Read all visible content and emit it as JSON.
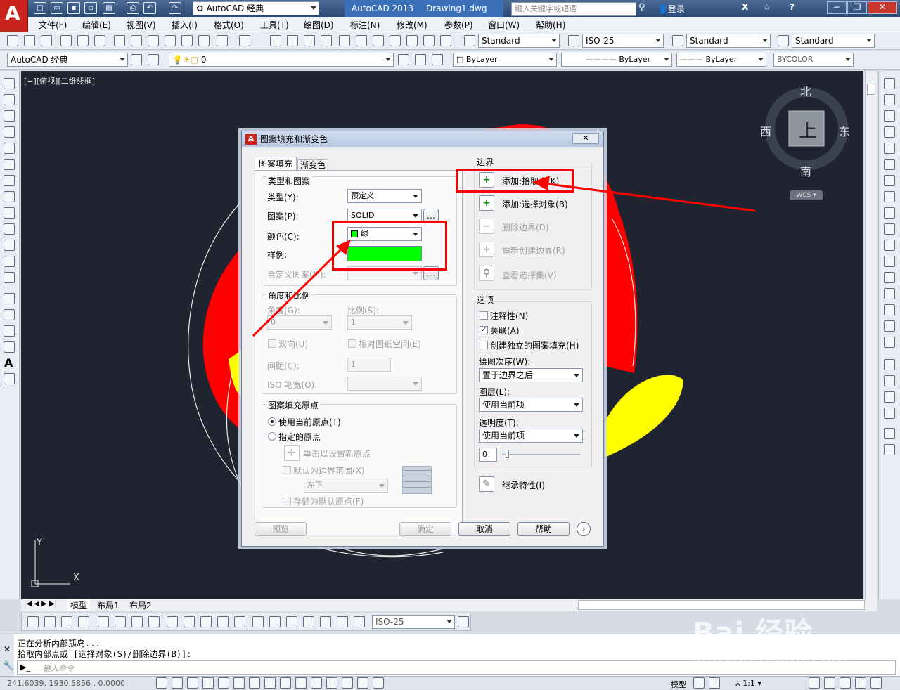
{
  "app": {
    "workspace": "AutoCAD 经典",
    "tab_product": "AutoCAD 2013",
    "tab_file": "Drawing1.dwg",
    "search_placeholder": "键入关键字或短语",
    "login": "登录"
  },
  "menu": [
    "文件(F)",
    "编辑(E)",
    "视图(V)",
    "插入(I)",
    "格式(O)",
    "工具(T)",
    "绘图(D)",
    "标注(N)",
    "修改(M)",
    "参数(P)",
    "窗口(W)",
    "帮助(H)"
  ],
  "styles": {
    "text": "Standard",
    "dim": "ISO-25",
    "table": "Standard",
    "mleader": "Standard"
  },
  "toolbar2": {
    "workspace": "AutoCAD 经典",
    "layer": "0",
    "color": "ByLayer",
    "linetype": "ByLayer",
    "lineweight": "ByLayer",
    "plotstyle": "BYCOLOR"
  },
  "viewport": {
    "label": "[−][俯视][二维线框]",
    "compass": {
      "n": "北",
      "s": "南",
      "e": "东",
      "w": "西",
      "top": "上",
      "wcs": "WCS"
    },
    "ucs_y": "Y",
    "ucs_x": "X"
  },
  "dialog": {
    "title": "图案填充和渐变色",
    "tabs": [
      "图案填充",
      "渐变色"
    ],
    "type_group": "类型和图案",
    "type_label": "类型(Y):",
    "type_value": "预定义",
    "pattern_label": "图案(P):",
    "pattern_value": "SOLID",
    "color_label": "颜色(C):",
    "color_value": "绿",
    "swatch_label": "样例:",
    "custom_label": "自定义图案(M):",
    "angle_group": "角度和比例",
    "angle_label": "角度(G):",
    "angle_value": "0",
    "scale_label": "比例(S):",
    "scale_value": "1",
    "double_label": "双向(U)",
    "relative_label": "相对图纸空间(E)",
    "spacing_label": "间距(C):",
    "spacing_value": "1",
    "iso_label": "ISO 笔宽(O):",
    "origin_group": "图案填充原点",
    "origin_current": "使用当前原点(T)",
    "origin_specified": "指定的原点",
    "click_origin": "单击以设置新原点",
    "default_extent": "默认为边界范围(X)",
    "extent_value": "左下",
    "store_origin": "存储为默认原点(F)",
    "boundary_group": "边界",
    "add_pick": "添加:拾取点(K)",
    "add_select": "添加:选择对象(B)",
    "remove_boundary": "删除边界(D)",
    "recreate_boundary": "重新创建边界(R)",
    "view_selection": "查看选择集(V)",
    "options_group": "选项",
    "annotative": "注释性(N)",
    "associative": "关联(A)",
    "separate": "创建独立的图案填充(H)",
    "draw_order_label": "绘图次序(W):",
    "draw_order_value": "置于边界之后",
    "layer_label": "图层(L):",
    "layer_value": "使用当前项",
    "transparency_label": "透明度(T):",
    "transparency_value": "使用当前项",
    "transparency_num": "0",
    "inherit": "继承特性(I)",
    "preview": "预览",
    "ok": "确定",
    "cancel": "取消",
    "help": "帮助",
    "swatch_color": "#00ff00"
  },
  "layout_tabs": [
    "模型",
    "布局1",
    "布局2"
  ],
  "dimstyle_bottom": "ISO-25",
  "command": {
    "line1": "正在分析内部孤岛...",
    "line2": "拾取内部点或 [选择对象(S)/删除边界(B)]:",
    "placeholder": "键入命令"
  },
  "status": {
    "coords": "241.6039, 1930.5856 , 0.0000",
    "model": "模型",
    "scale": "1:1"
  },
  "watermark": {
    "brand": "Bai 经验",
    "url": "jingyan.baidu.com"
  }
}
